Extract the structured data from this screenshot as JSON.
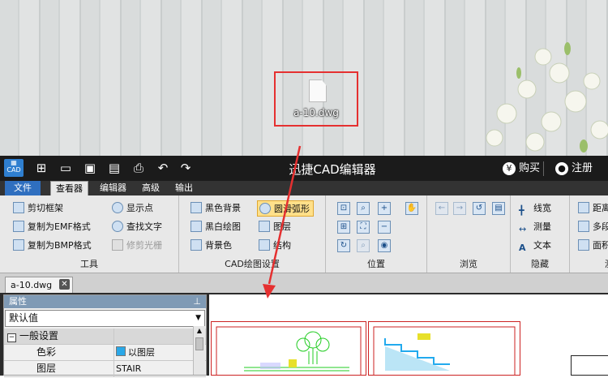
{
  "desktop": {
    "file_name": "a-10.dwg"
  },
  "app": {
    "logo_text": "CAD",
    "title": "迅捷CAD编辑器",
    "buy_label": "购买",
    "register_label": "注册",
    "menu_tabs": [
      "文件",
      "查看器",
      "编辑器",
      "高级",
      "输出"
    ],
    "active_tab": "查看器"
  },
  "ribbon": {
    "tools": {
      "label": "工具",
      "items": [
        "剪切框架",
        "复制为EMF格式",
        "复制为BMP格式",
        "显示点",
        "查找文字",
        "修剪光栅"
      ]
    },
    "draw_settings": {
      "label": "CAD绘图设置",
      "items": [
        "黑色背景",
        "黑白绘图",
        "背景色",
        "圆滑弧形",
        "图层",
        "结构"
      ]
    },
    "position": {
      "label": "位置"
    },
    "browse": {
      "label": "浏览"
    },
    "hide": {
      "label": "隐藏",
      "items": [
        "线宽",
        "测量",
        "文本"
      ]
    },
    "more": {
      "items": [
        "距离",
        "多段",
        "面积"
      ],
      "label_fragment": "测"
    }
  },
  "document": {
    "tab_label": "a-10.dwg"
  },
  "properties": {
    "header": "属性",
    "pin_icon": "pin-icon",
    "select_value": "默认值",
    "section": "一般设置",
    "rows": [
      {
        "key": "色彩",
        "value": "以图层"
      },
      {
        "key": "图层",
        "value": "STAIR"
      }
    ]
  },
  "colors": {
    "accent_red": "#e53030",
    "file_tab_blue": "#2f6fbf",
    "panel_header": "#7f9ab5"
  }
}
